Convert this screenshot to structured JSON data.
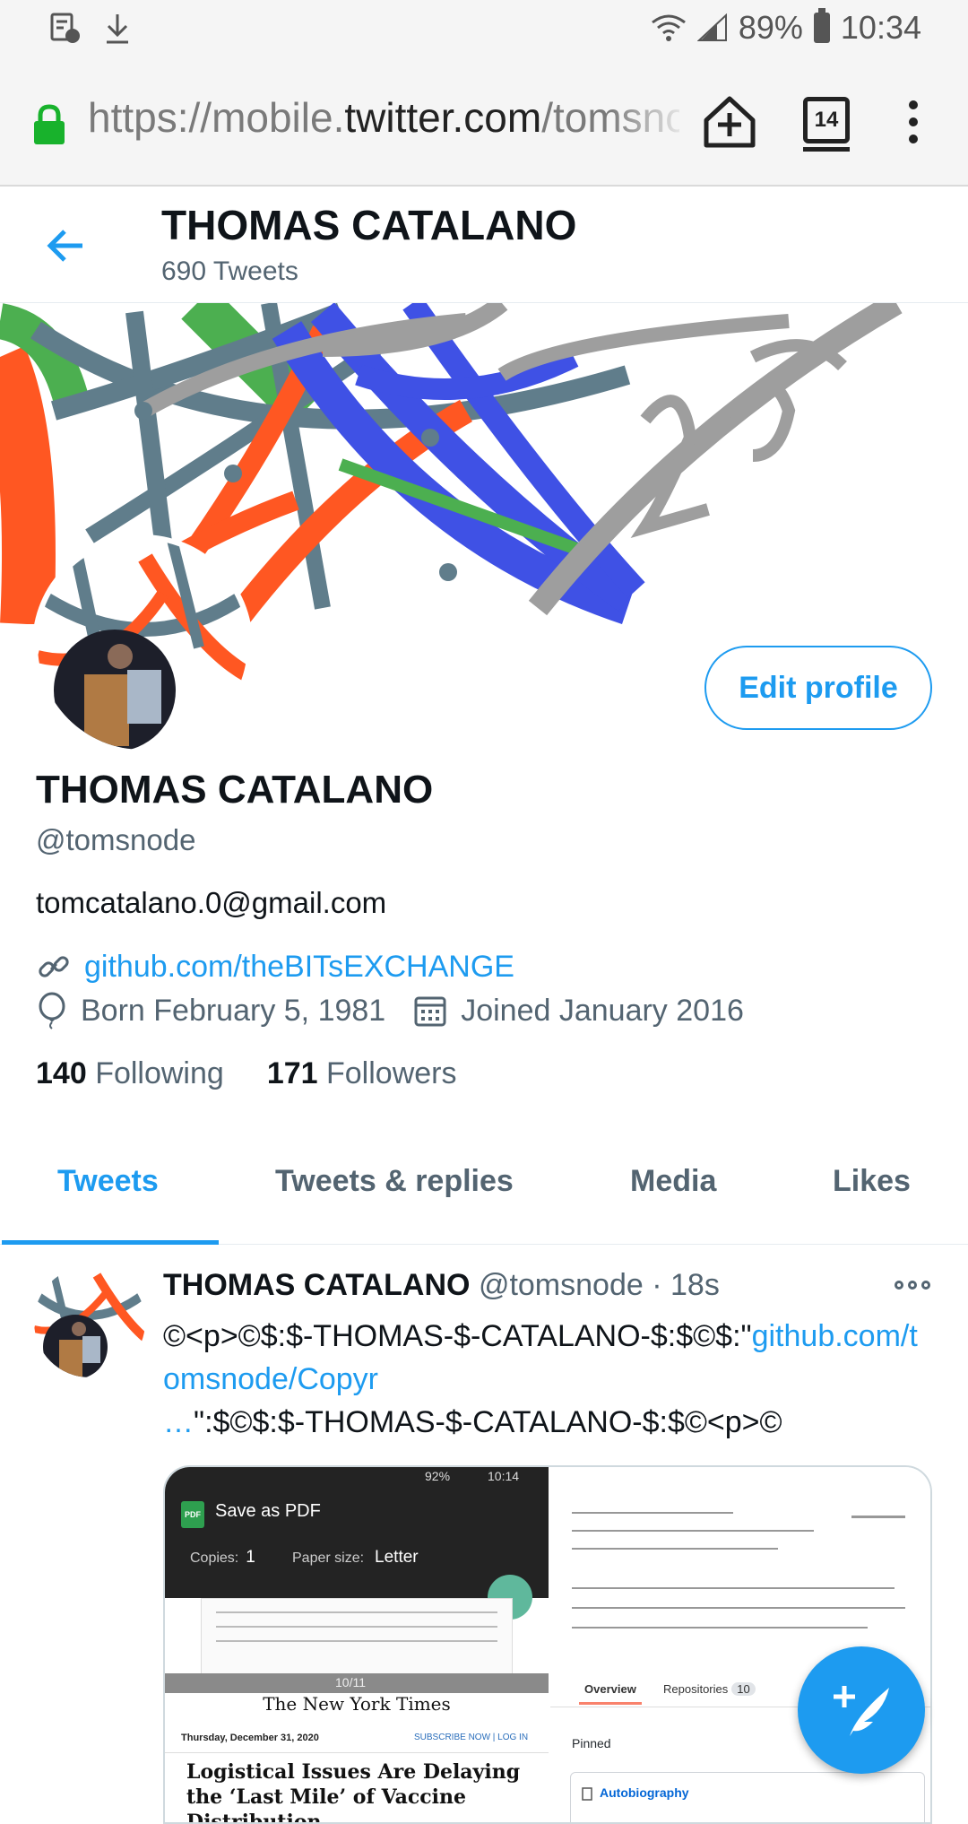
{
  "status_bar": {
    "battery": "89%",
    "time": "10:34"
  },
  "browser": {
    "url_scheme": "https://mobile.",
    "url_domain": "twitter.com",
    "url_path": "/tomsnode",
    "tab_count": "14"
  },
  "header": {
    "name": "THOMAS CATALANO",
    "tweet_count": "690 Tweets"
  },
  "profile": {
    "edit_label": "Edit profile",
    "name": "THOMAS CATALANO",
    "handle": "@tomsnode",
    "bio": "tomcatalano.0@gmail.com",
    "link": "github.com/theBITsEXCHANGE",
    "born": "Born February 5, 1981",
    "joined": "Joined January 2016",
    "following_count": "140",
    "following_label": "Following",
    "followers_count": "171",
    "followers_label": "Followers"
  },
  "tabs": [
    "Tweets",
    "Tweets & replies",
    "Media",
    "Likes"
  ],
  "tweet": {
    "name": "THOMAS CATALANO",
    "handle": "@tomsnode",
    "sep": "·",
    "time": "18s",
    "text_start": "©<p>©$:$-THOMAS-$-CATALANO-$:$©$:\"",
    "link": "github.com/tomsnode/Copyr",
    "ellipsis": "…",
    "text_end": "\":$©$:$-THOMAS-$-CATALANO-$:$©<p>©"
  },
  "media": {
    "left": {
      "battery": "92%",
      "time": "10:14",
      "pdf_badge": "PDF",
      "save_as": "Save as PDF",
      "copies_label": "Copies:",
      "copies_value": "1",
      "paper_label": "Paper size:",
      "paper_value": "Letter",
      "page_indicator": "10/11",
      "nyt_title": "The New York Times",
      "date": "Thursday, December 31, 2020",
      "subscribe": "SUBSCRIBE NOW | LOG IN",
      "headline": "Logistical Issues Are Delaying the ‘Last Mile’ of Vaccine Distribution"
    },
    "right": {
      "tab_overview": "Overview",
      "tab_repos": "Repositories",
      "repo_count": "10",
      "pinned": "Pinned",
      "pinned_item": "Autobiography"
    }
  },
  "colors": {
    "accent": "#1d9bf0",
    "text_secondary": "#536471"
  },
  "icons": [
    "download-icon",
    "lock-icon",
    "add-to-home-icon",
    "more-vert-icon",
    "back-arrow-icon",
    "link-icon",
    "balloon-icon",
    "calendar-icon",
    "more-horizontal-icon",
    "compose-tweet-icon"
  ]
}
